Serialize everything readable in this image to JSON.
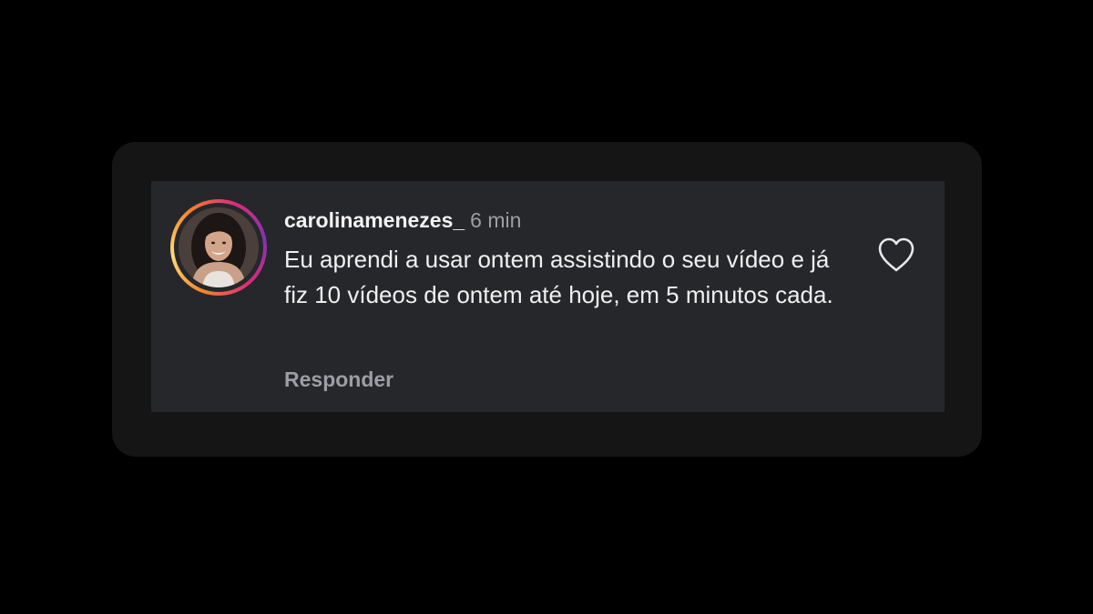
{
  "comment": {
    "username": "carolinamenezes_",
    "timestamp": "6 min",
    "text": "Eu aprendi a usar ontem assistindo o seu vídeo e já fiz 10 vídeos de ontem até hoje, em 5 minutos cada.",
    "reply_label": "Responder",
    "liked": false
  },
  "icons": {
    "like": "heart-outline-icon",
    "avatar": "profile-photo"
  },
  "colors": {
    "background": "#000000",
    "card": "#151515",
    "panel": "#25272b",
    "username": "#f2f2f2",
    "muted": "#9c9ea3",
    "story_ring_start": "#f58529",
    "story_ring_end": "#dd2a7b"
  }
}
